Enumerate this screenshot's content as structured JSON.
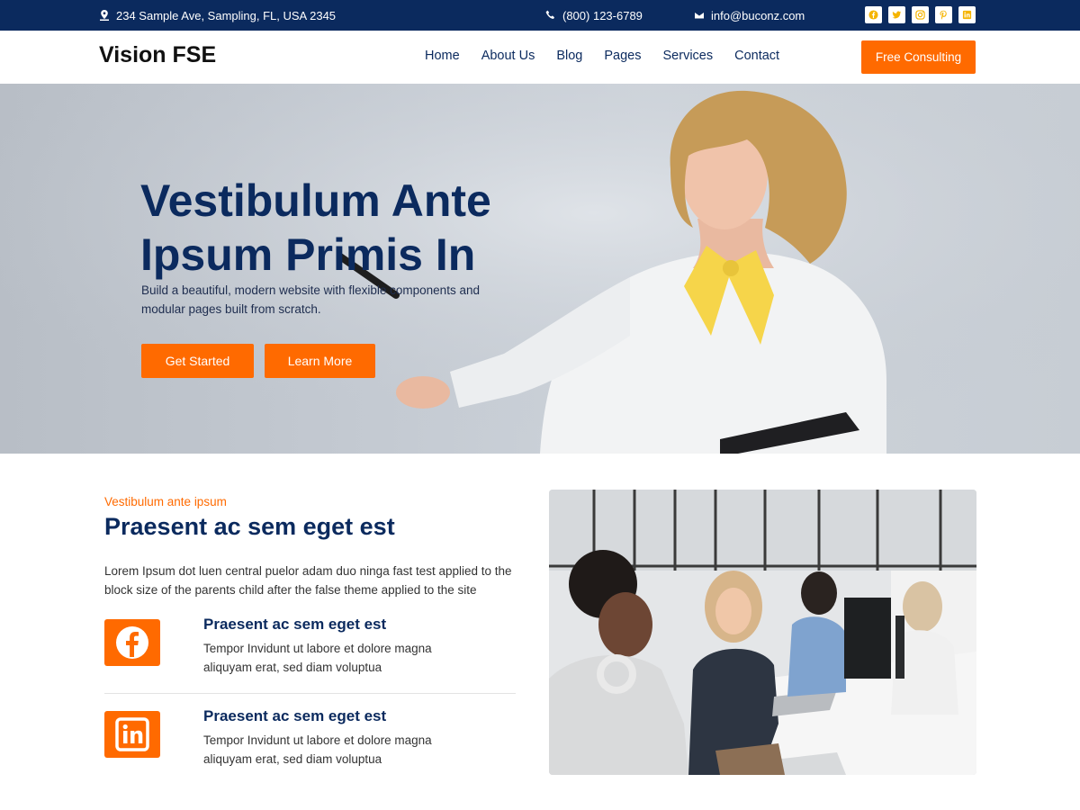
{
  "topbar": {
    "address": "234 Sample Ave, Sampling, FL, USA 2345",
    "phone": "(800) 123-6789",
    "email": "info@buconz.com",
    "socials": [
      "facebook-icon",
      "twitter-icon",
      "instagram-icon",
      "pinterest-icon",
      "linkedin-icon"
    ]
  },
  "header": {
    "logo": "Vision FSE",
    "nav": [
      "Home",
      "About Us",
      "Blog",
      "Pages",
      "Services",
      "Contact"
    ],
    "cta": "Free Consulting"
  },
  "hero": {
    "title_line1": "Vestibulum Ante",
    "title_line2": "Ipsum Primis In",
    "subtitle": "Build a beautiful, modern website with flexible components and modular pages built from scratch.",
    "primary_button": "Get Started",
    "secondary_button": "Learn More"
  },
  "about": {
    "eyebrow": "Vestibulum ante ipsum",
    "title": "Praesent ac sem eget est",
    "body": "Lorem Ipsum dot luen central puelor adam duo ninga fast test applied to the block size of the parents child after the false theme applied to the site",
    "features": [
      {
        "icon": "facebook-icon",
        "title": "Praesent ac sem eget est",
        "text": "Tempor Invidunt ut labore et dolore magna aliquyam erat, sed diam voluptua"
      },
      {
        "icon": "linkedin-icon",
        "title": "Praesent ac sem eget est",
        "text": "Tempor Invidunt ut labore et dolore magna aliquyam erat, sed diam voluptua"
      }
    ]
  },
  "colors": {
    "navy": "#0b2a5e",
    "accent": "#ff6a00",
    "social_icon": "#f5b400"
  }
}
